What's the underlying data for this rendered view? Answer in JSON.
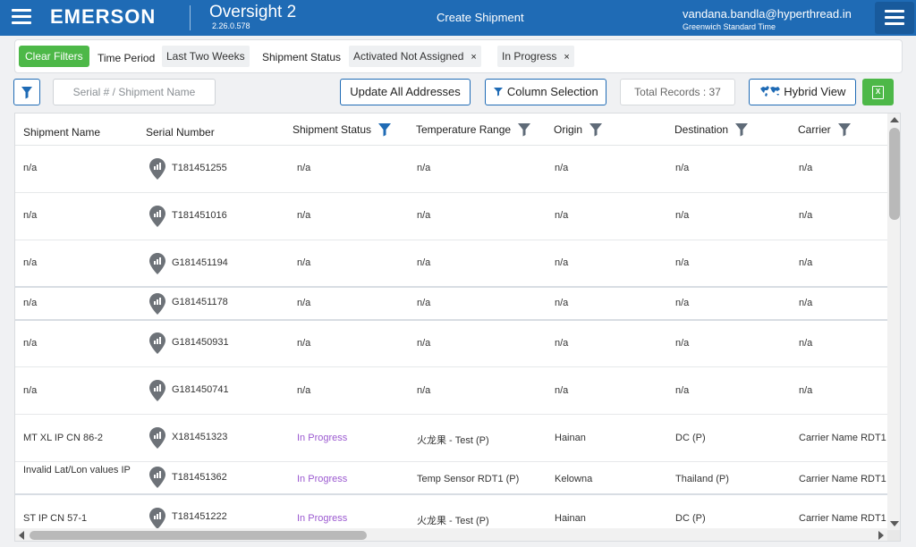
{
  "header": {
    "brand": "EMERSON",
    "product": "Oversight 2",
    "version": "2.26.0.578",
    "page_title": "Create Shipment",
    "user_email": "vandana.bandla@hyperthread.in",
    "timezone": "Greenwich Standard Time",
    "brand_color": "#1f6bb5"
  },
  "filters": {
    "clear_label": "Clear Filters",
    "time_period_label": "Time Period",
    "time_period_value": "Last Two Weeks",
    "shipment_status_label": "Shipment Status",
    "status_chips": [
      "Activated Not Assigned",
      "In Progress"
    ],
    "chip_close": "×"
  },
  "toolbar": {
    "search_placeholder": "Serial # / Shipment Name",
    "update_addresses": "Update All Addresses",
    "column_selection": "Column Selection",
    "total_records": "Total Records : 37",
    "hybrid_view": "Hybrid View",
    "excel_glyph": "X",
    "accent_green": "#4db848"
  },
  "table": {
    "columns": [
      "Shipment Name",
      "Serial Number",
      "Shipment Status",
      "Temperature Range",
      "Origin",
      "Destination",
      "Carrier"
    ],
    "rows": [
      [
        "n/a",
        "T181451255",
        "n/a",
        "n/a",
        "n/a",
        "n/a",
        "n/a"
      ],
      [
        "n/a",
        "T181451016",
        "n/a",
        "n/a",
        "n/a",
        "n/a",
        "n/a"
      ],
      [
        "n/a",
        "G181451194",
        "n/a",
        "n/a",
        "n/a",
        "n/a",
        "n/a"
      ],
      [
        "n/a",
        "G181451178",
        "n/a",
        "n/a",
        "n/a",
        "n/a",
        "n/a"
      ],
      [
        "n/a",
        "G181450931",
        "n/a",
        "n/a",
        "n/a",
        "n/a",
        "n/a"
      ],
      [
        "n/a",
        "G181450741",
        "n/a",
        "n/a",
        "n/a",
        "n/a",
        "n/a"
      ],
      [
        "MT XL IP CN 86-2",
        "X181451323",
        "In Progress",
        "火龙果 - Test (P)",
        "Hainan",
        "DC (P)",
        "Carrier Name RDT1"
      ],
      [
        "Invalid Lat/Lon values IP",
        "T181451362",
        "In Progress",
        "Temp Sensor RDT1 (P)",
        "Kelowna",
        "Thailand (P)",
        "Carrier Name RDT1"
      ],
      [
        "ST IP CN 57-1",
        "T181451222",
        "In Progress",
        "火龙果 - Test (P)",
        "Hainan",
        "DC (P)",
        "Carrier Name RDT1"
      ]
    ],
    "status_color_in_progress": "#9b59d0"
  }
}
